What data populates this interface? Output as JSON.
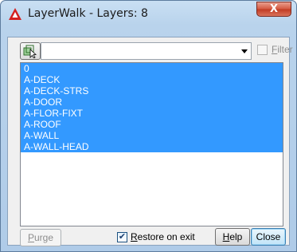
{
  "window": {
    "title": "LayerWalk - Layers: 8",
    "close_glyph": "X"
  },
  "toolbar": {
    "select_objects_icon": "select-objects-icon",
    "combo_value": "",
    "filter_label_rest": "ilter",
    "filter_label_accel": "F",
    "filter_checked": false
  },
  "layers": [
    "0",
    "A-DECK",
    "A-DECK-STRS",
    "A-DOOR",
    "A-FLOR-FIXT",
    "A-ROOF",
    "A-WALL",
    "A-WALL-HEAD"
  ],
  "footer": {
    "purge_accel": "P",
    "purge_rest": "urge",
    "restore_accel": "R",
    "restore_rest": "estore on exit",
    "restore_checked": true,
    "help_accel": "H",
    "help_rest": "elp",
    "close_label": "Close"
  },
  "colors": {
    "selection": "#3399ff",
    "title_close": "#c13a22",
    "app_icon": "#d42020"
  }
}
